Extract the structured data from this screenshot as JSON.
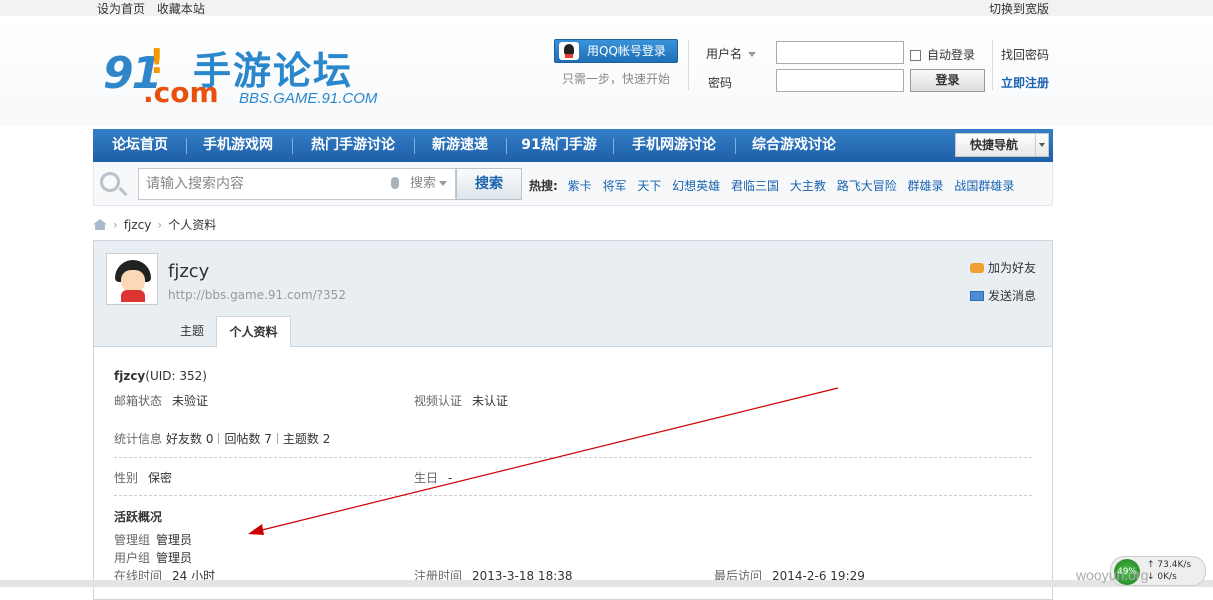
{
  "topbar": {
    "set_home": "设为首页",
    "bookmark": "收藏本站",
    "switch_wide": "切换到宽版"
  },
  "logo": {
    "number": "91",
    "dot": "!",
    "com": ".com",
    "title": "手游论坛",
    "url": "BBS.GAME.91.COM"
  },
  "login": {
    "qq_button": "用QQ帐号登录",
    "qq_sub": "只需一步，快速开始",
    "username_label": "用户名",
    "password_label": "密码",
    "auto_login": "自动登录",
    "login_button": "登录",
    "find_password": "找回密码",
    "register": "立即注册"
  },
  "nav": {
    "items": [
      "论坛首页",
      "手机游戏网",
      "热门手游讨论",
      "新游速递",
      "91热门手游",
      "手机网游讨论",
      "综合游戏讨论"
    ],
    "quick_nav": "快捷导航"
  },
  "search": {
    "placeholder": "请输入搜索内容",
    "type": "搜索",
    "button": "搜索",
    "hot_label": "热搜:",
    "hot_items": [
      "紫卡",
      "将军",
      "天下",
      "幻想英雄",
      "君临三国",
      "大主教",
      "路飞大冒险",
      "群雄录",
      "战国群雄录"
    ]
  },
  "breadcrumb": {
    "user": "fjzcy",
    "page": "个人资料"
  },
  "profile": {
    "name": "fjzcy",
    "url": "http://bbs.game.91.com/?352",
    "add_friend": "加为好友",
    "send_message": "发送消息",
    "tabs": [
      "主题",
      "个人资料"
    ]
  },
  "details": {
    "uid_name": "fjzcy",
    "uid": "(UID: 352)",
    "email_status_label": "邮箱状态",
    "email_status": "未验证",
    "video_label": "视频认证",
    "video_status": "未认证",
    "stats_label": "统计信息",
    "friends": "好友数 0",
    "replies": "回帖数 7",
    "topics": "主题数 2",
    "gender_label": "性别",
    "gender": "保密",
    "birthday_label": "生日",
    "birthday": "-",
    "activity_title": "活跃概况",
    "admin_group_label": "管理组",
    "admin_group": "管理员",
    "user_group_label": "用户组",
    "user_group": "管理员",
    "online_label": "在线时间",
    "online": "24 小时",
    "reg_label": "注册时间",
    "reg_time": "2013-3-18 18:38",
    "last_visit_label": "最后访问",
    "last_visit": "2014-2-6 19:29"
  },
  "tray": {
    "cpu": "49%",
    "up": "73.4K/s",
    "down": "0K/s"
  },
  "watermark": "wooyun.org",
  "colors": {
    "nav": "#2a6fb8",
    "link": "#1b64b0",
    "annotation_arrow": "#cc0000"
  }
}
